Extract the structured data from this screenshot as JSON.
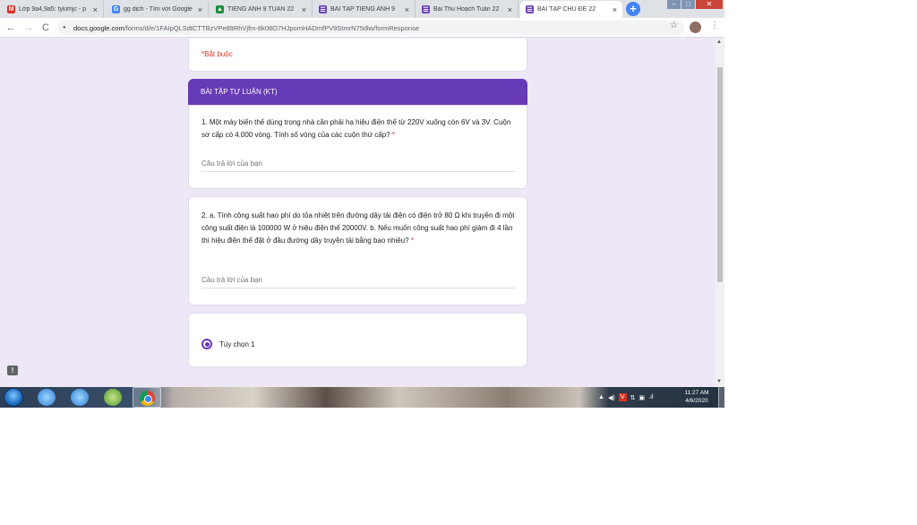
{
  "browser": {
    "tabs": [
      {
        "label": "Lớp 9a4,9a5: tykimjc - p",
        "icon": "gmail-icon",
        "color": "#d93025",
        "glyph": "M",
        "active": false
      },
      {
        "label": "gg dịch - Tìm với Google",
        "icon": "google-icon",
        "color": "#4285f4",
        "glyph": "G",
        "active": false
      },
      {
        "label": "TIẾNG ANH 9 TUẦN 22",
        "icon": "classroom-icon",
        "color": "#1e8e3e",
        "glyph": "▲",
        "active": false
      },
      {
        "label": "BÀI TẬP TIẾNG ANH 9",
        "icon": "forms-icon",
        "color": "#673ab7",
        "glyph": "☰",
        "active": false
      },
      {
        "label": "Bài Thu Hoạch Tuần 22",
        "icon": "forms-icon",
        "color": "#673ab7",
        "glyph": "☰",
        "active": false
      },
      {
        "label": "BÀI TẬP CHỦ ĐỀ 22",
        "icon": "forms-icon",
        "color": "#673ab7",
        "glyph": "☰",
        "active": true
      }
    ],
    "url_host": "docs.google.com",
    "url_path": "/forms/d/e/1FAIpQLSdtCTTBzVPe89RhVjfm-8k08O7HJpomHADmfPV9StmrN75dlw/formResponse"
  },
  "form": {
    "required_note": "*Bắt buộc",
    "section_title": "BÀI TẬP TỰ LUẬN (KT)",
    "questions": [
      {
        "text": "1. Một máy biến thế dùng trong nhà cần phải hạ hiệu điện thế từ 220V xuống còn 6V và 3V. Cuộn sơ cấp có 4.000 vòng. Tính số vòng của các cuộn thứ cấp?",
        "required_mark": "*",
        "placeholder": "Câu trả lời của bạn"
      },
      {
        "text": "2. a. Tính công suất hao phí do tỏa nhiệt trên đường dây tải điện có điện trở 80 Ω khi truyền đi một công suất điện là 100000 W ở hiệu điện thế 20000V. b. Nếu muốn công suất hao phí giảm đi 4 lần thì hiệu điện thế đặt ở đầu đường dây truyền tải bằng bao nhiêu?",
        "required_mark": "*",
        "placeholder": "Câu trả lời của bạn"
      }
    ],
    "radio_option": "Tùy chọn 1",
    "radio_selected": true,
    "accent_color": "#673ab7",
    "background_color": "#ede7f6"
  },
  "taskbar": {
    "clock_time": "11:27 AM",
    "clock_date": "4/6/2020"
  }
}
